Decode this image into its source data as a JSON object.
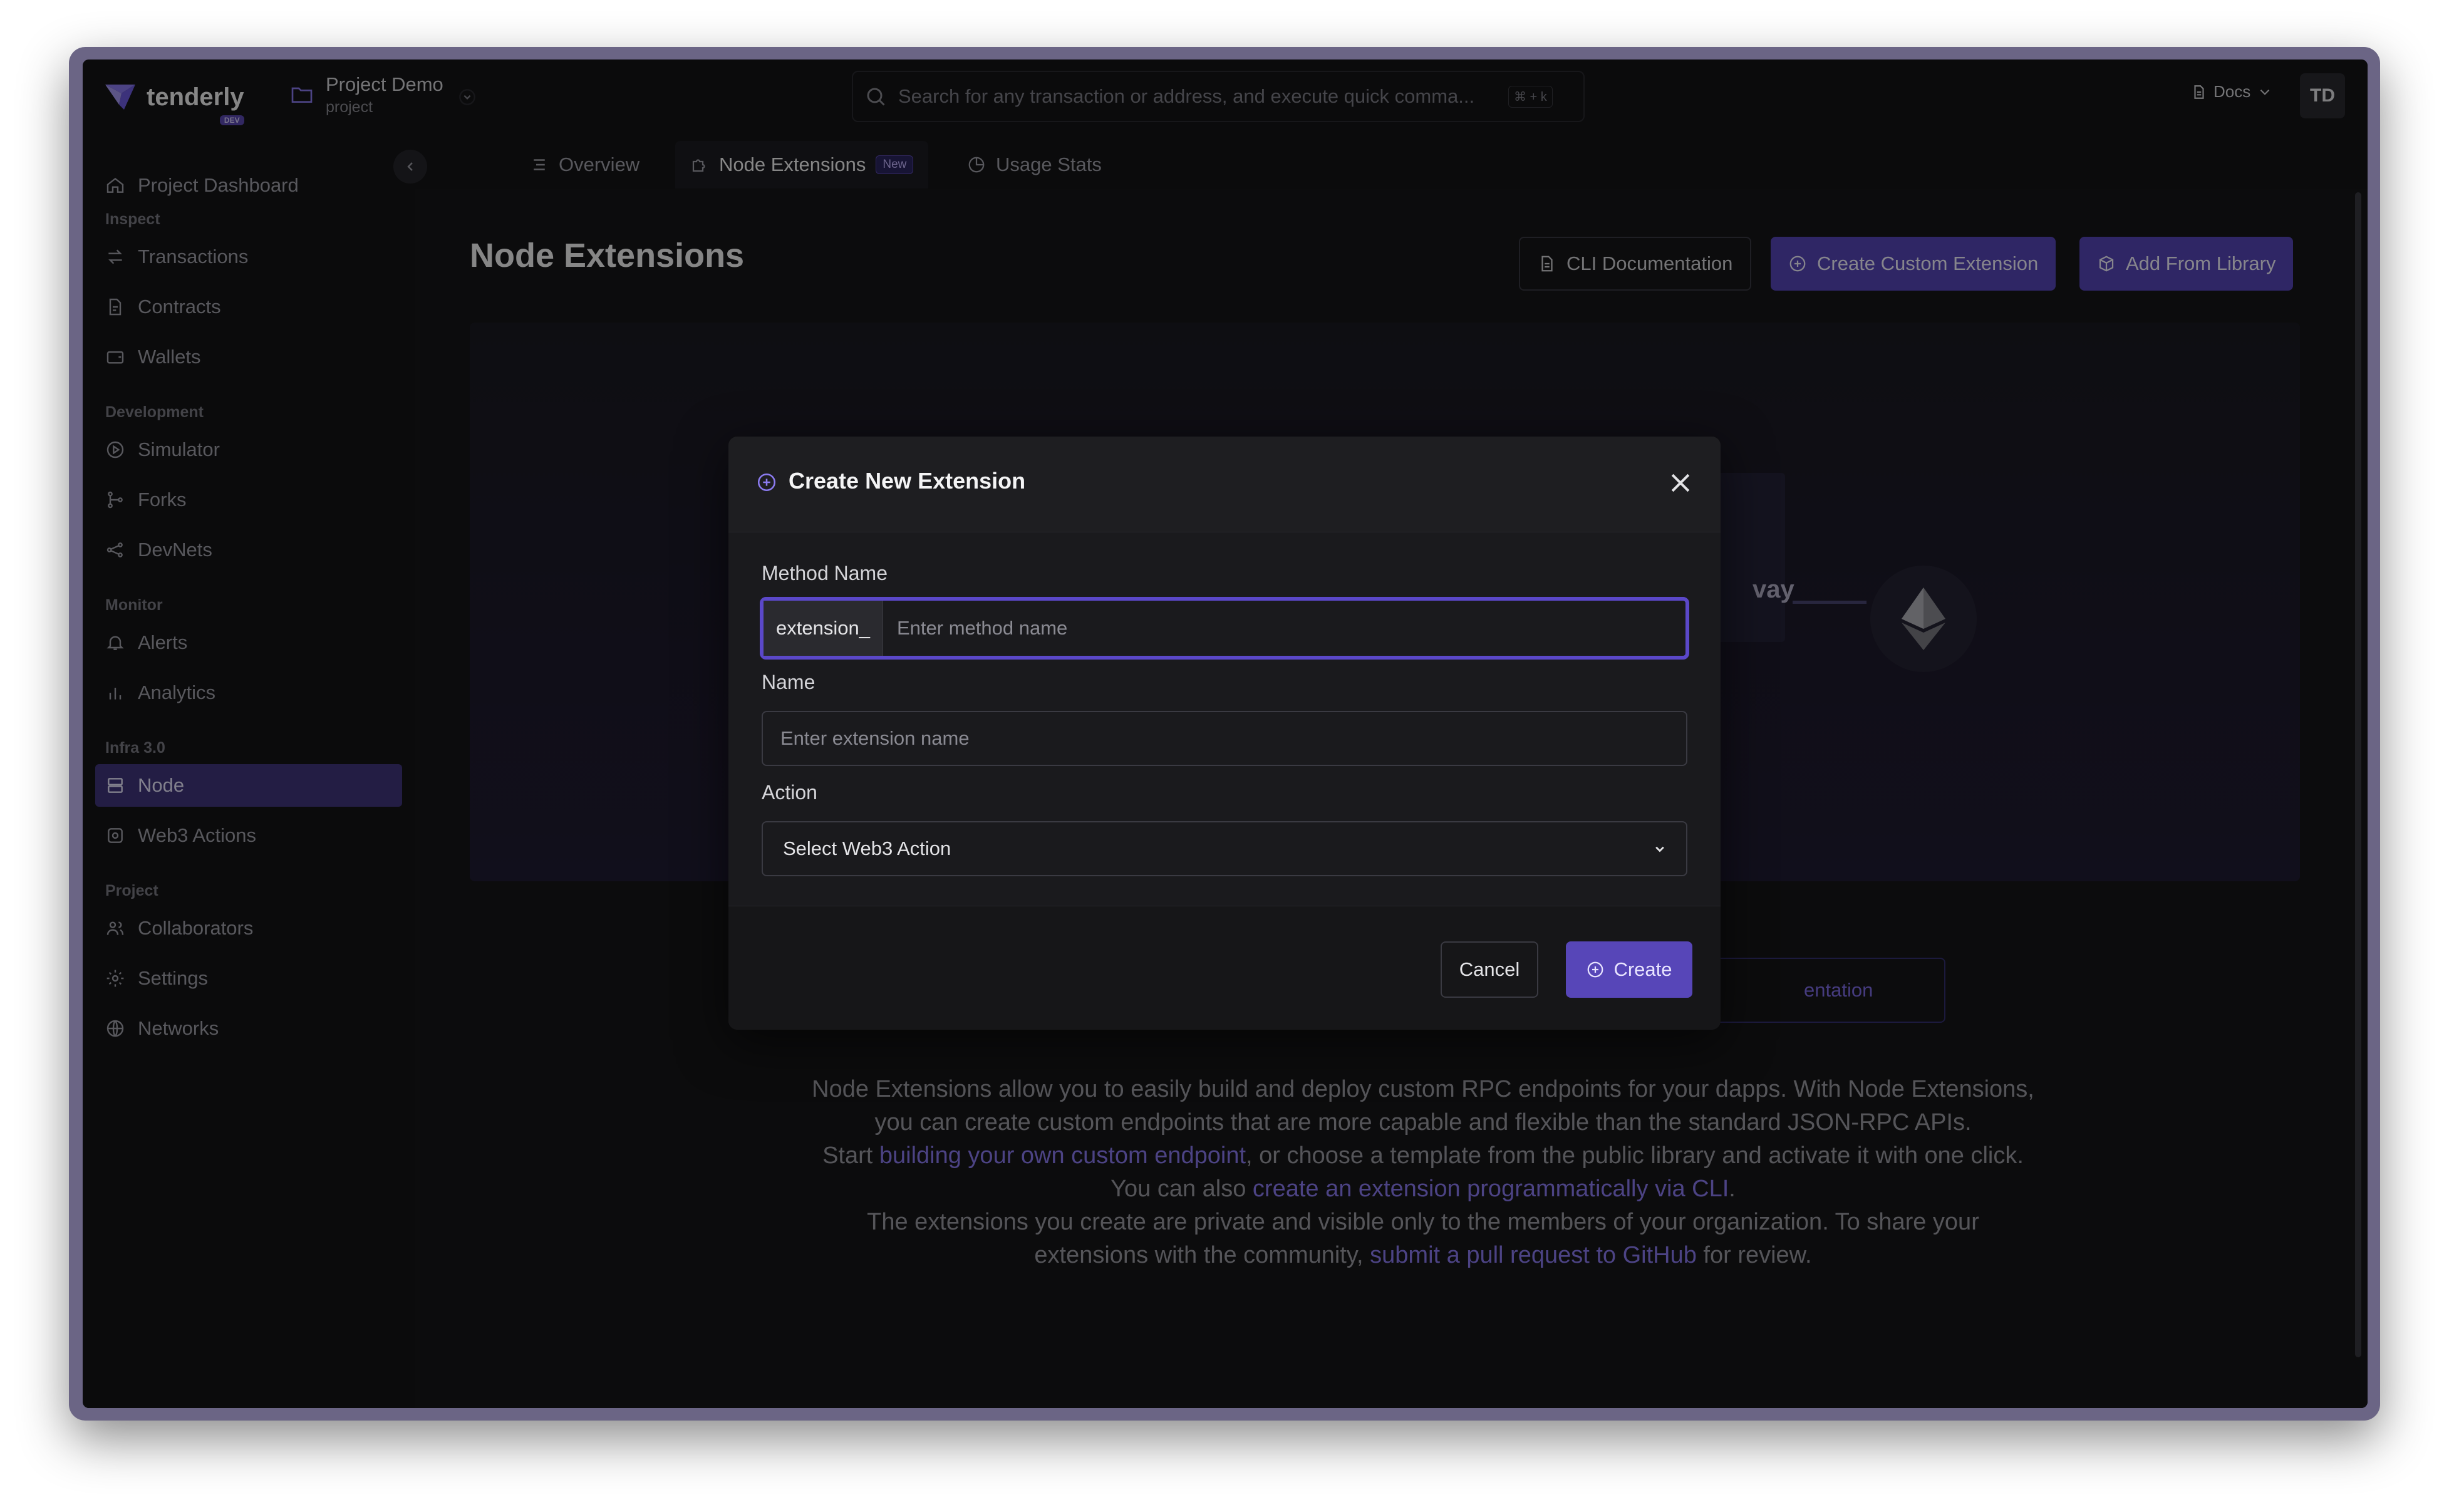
{
  "topbar": {
    "logo_text": "tenderly",
    "logo_badge": "DEV",
    "project_name": "Project Demo",
    "project_sub": "project",
    "search_placeholder": "Search for any transaction or address, and execute quick comma...",
    "search_shortcut": "⌘ + k",
    "docs_label": "Docs",
    "avatar_initials": "TD"
  },
  "sidebar": {
    "dashboard": "Project Dashboard",
    "sections": {
      "inspect": "Inspect",
      "development": "Development",
      "monitor": "Monitor",
      "infra": "Infra 3.0",
      "project": "Project"
    },
    "items": {
      "transactions": "Transactions",
      "contracts": "Contracts",
      "wallets": "Wallets",
      "simulator": "Simulator",
      "forks": "Forks",
      "devnets": "DevNets",
      "alerts": "Alerts",
      "analytics": "Analytics",
      "node": "Node",
      "web3_actions": "Web3 Actions",
      "collaborators": "Collaborators",
      "settings": "Settings",
      "networks": "Networks"
    }
  },
  "tabs": {
    "overview": "Overview",
    "node_extensions": "Node Extensions",
    "new_badge": "New",
    "usage_stats": "Usage Stats"
  },
  "page": {
    "title": "Node Extensions",
    "cli_docs": "CLI Documentation",
    "create_custom": "Create Custom Extension",
    "add_library": "Add From Library",
    "hero_partial_text": "vay",
    "hero_doc_partial": "entation"
  },
  "description": {
    "line1": "Node Extensions allow you to easily build and deploy custom RPC endpoints for your dapps. With Node Extensions, you can create custom endpoints that are more capable and flexible than the standard JSON-RPC APIs.",
    "start": "Start ",
    "link_build": "building your own custom endpoint",
    "mid": ", or choose a template from the public library and activate it with one click. You can also ",
    "link_cli": "create an extension programmatically via CLI",
    "dot": ".",
    "line3": "The extensions you create are private and visible only to the members of your organization. To share your extensions with the community, ",
    "link_pr": "submit a pull request to GitHub",
    "end": " for review."
  },
  "modal": {
    "title": "Create New Extension",
    "method_label": "Method Name",
    "method_prefix": "extension_",
    "method_placeholder": "Enter method name",
    "name_label": "Name",
    "name_placeholder": "Enter extension name",
    "action_label": "Action",
    "action_selected": "Select Web3 Action",
    "cancel": "Cancel",
    "create": "Create"
  },
  "colors": {
    "accent": "#5746b8",
    "focus_ring": "#5b48c9",
    "link": "#8b7bf0"
  }
}
